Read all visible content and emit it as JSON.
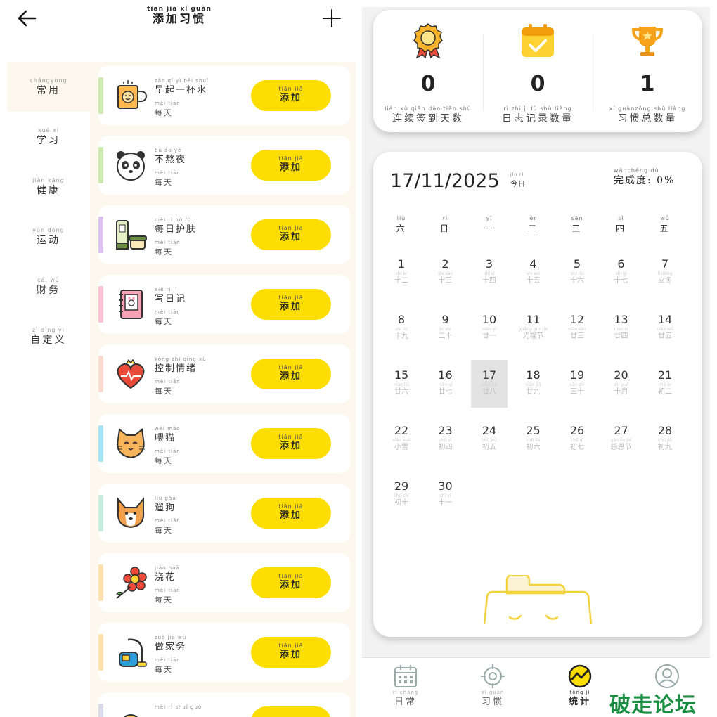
{
  "header": {
    "title_py": "tiān jiā  xí guàn",
    "title": "添加习惯"
  },
  "sidebar": {
    "items": [
      {
        "py": "chángyòng",
        "label": "常用"
      },
      {
        "py": "xué  xí",
        "label": "学习"
      },
      {
        "py": "jiàn kāng",
        "label": "健康"
      },
      {
        "py": "yùn dòng",
        "label": "运动"
      },
      {
        "py": "cái  wù",
        "label": "财务"
      },
      {
        "py": "zì dìng yì",
        "label": "自定义"
      }
    ]
  },
  "habits": [
    {
      "py": "zǎo  qǐ   yì  bēi shuǐ",
      "name": "早起一杯水",
      "freq_py": "měi tiān",
      "freq": "每天",
      "icon": "mug-icon",
      "bar": "#cdeab0",
      "add_py": "tiān jiā",
      "add": "添加"
    },
    {
      "py": "bù   áo   yè",
      "name": "不熬夜",
      "freq_py": "měi tiān",
      "freq": "每天",
      "icon": "panda-icon",
      "bar": "#cdeab0",
      "add_py": "tiān jiā",
      "add": "添加"
    },
    {
      "py": "měi  rì   hù   fū",
      "name": "每日护肤",
      "freq_py": "měi tiān",
      "freq": "每天",
      "icon": "skincare-icon",
      "bar": "#dcc2ef",
      "add_py": "tiān jiā",
      "add": "添加"
    },
    {
      "py": "xiě  rì   jì",
      "name": "写日记",
      "freq_py": "měi tiān",
      "freq": "每天",
      "icon": "diary-icon",
      "bar": "#f9c4d6",
      "add_py": "tiān jiā",
      "add": "添加"
    },
    {
      "py": "kòng zhì qíng xù",
      "name": "控制情绪",
      "freq_py": "měi tiān",
      "freq": "每天",
      "icon": "heart-icon",
      "bar": "#fcdcd0",
      "add_py": "tiān jiā",
      "add": "添加"
    },
    {
      "py": "wèi māo",
      "name": "喂猫",
      "freq_py": "měi tiān",
      "freq": "每天",
      "icon": "cat-icon",
      "bar": "#a9e2f0",
      "add_py": "tiān jiā",
      "add": "添加"
    },
    {
      "py": "liù  gǒu",
      "name": "遛狗",
      "freq_py": "měi tiān",
      "freq": "每天",
      "icon": "dog-icon",
      "bar": "#c9ecdd",
      "add_py": "tiān jiā",
      "add": "添加"
    },
    {
      "py": "jiāo huā",
      "name": "浇花",
      "freq_py": "měi tiān",
      "freq": "每天",
      "icon": "flower-icon",
      "bar": "#fde1b0",
      "add_py": "tiān jiā",
      "add": "添加"
    },
    {
      "py": "zuò  jiā  wù",
      "name": "做家务",
      "freq_py": "měi tiān",
      "freq": "每天",
      "icon": "vacuum-icon",
      "bar": "#fde1b0",
      "add_py": "tiān jiā",
      "add": "添加"
    },
    {
      "py": "měi  rì shuǐ guǒ",
      "name": "",
      "freq_py": "",
      "freq": "",
      "icon": "fruit-icon",
      "bar": "#dcdcec",
      "add_py": "",
      "add": ""
    }
  ],
  "stats": [
    {
      "icon": "medal-icon",
      "value": "0",
      "py": "lián  xù  qiān dào tiān shù",
      "label": "连续签到天数"
    },
    {
      "icon": "calendar-check-icon",
      "value": "0",
      "py": "rì   zhì   jì   lù  shù liàng",
      "label": "日志记录数量"
    },
    {
      "icon": "trophy-icon",
      "value": "1",
      "py": "xí  guànzǒng shù liàng",
      "label": "习惯总数量"
    }
  ],
  "calendar": {
    "date": "17/11/2025",
    "today_py": "jīn rì",
    "today": "今日",
    "progress_py": "wánchéng dù",
    "progress_label": "完成度:",
    "progress_value": "0%",
    "weekdays": [
      {
        "py": "liù",
        "label": "六"
      },
      {
        "py": "rì",
        "label": "日"
      },
      {
        "py": "yī",
        "label": "一"
      },
      {
        "py": "èr",
        "label": "二"
      },
      {
        "py": "sān",
        "label": "三"
      },
      {
        "py": "sì",
        "label": "四"
      },
      {
        "py": "wǔ",
        "label": "五"
      }
    ],
    "selected_day": "17",
    "days": [
      {
        "num": "1",
        "lunar_py": "shí èr",
        "lunar": "十二"
      },
      {
        "num": "2",
        "lunar_py": "shí sān",
        "lunar": "十三"
      },
      {
        "num": "3",
        "lunar_py": "shí sì",
        "lunar": "十四"
      },
      {
        "num": "4",
        "lunar_py": "shí wǔ",
        "lunar": "十五"
      },
      {
        "num": "5",
        "lunar_py": "shí liù",
        "lunar": "十六"
      },
      {
        "num": "6",
        "lunar_py": "shí qī",
        "lunar": "十七"
      },
      {
        "num": "7",
        "lunar_py": "lì dōng",
        "lunar": "立冬"
      },
      {
        "num": "8",
        "lunar_py": "shí jiǔ",
        "lunar": "十九"
      },
      {
        "num": "9",
        "lunar_py": "èr shí",
        "lunar": "二十"
      },
      {
        "num": "10",
        "lunar_py": "niàn yī",
        "lunar": "廿一"
      },
      {
        "num": "11",
        "lunar_py": "guāng gùn jié",
        "lunar": "光棍节"
      },
      {
        "num": "12",
        "lunar_py": "niàn sān",
        "lunar": "廿三"
      },
      {
        "num": "13",
        "lunar_py": "niàn sì",
        "lunar": "廿四"
      },
      {
        "num": "14",
        "lunar_py": "niàn wǔ",
        "lunar": "廿五"
      },
      {
        "num": "15",
        "lunar_py": "niàn liù",
        "lunar": "廿六"
      },
      {
        "num": "16",
        "lunar_py": "niàn qī",
        "lunar": "廿七"
      },
      {
        "num": "17",
        "lunar_py": "niàn bā",
        "lunar": "廿八"
      },
      {
        "num": "18",
        "lunar_py": "niàn jiǔ",
        "lunar": "廿九"
      },
      {
        "num": "19",
        "lunar_py": "sān shí",
        "lunar": "三十"
      },
      {
        "num": "20",
        "lunar_py": "shí yuè",
        "lunar": "十月"
      },
      {
        "num": "21",
        "lunar_py": "chū èr",
        "lunar": "初二"
      },
      {
        "num": "22",
        "lunar_py": "xiǎo xuě",
        "lunar": "小雪"
      },
      {
        "num": "23",
        "lunar_py": "chū sì",
        "lunar": "初四"
      },
      {
        "num": "24",
        "lunar_py": "chū wǔ",
        "lunar": "初五"
      },
      {
        "num": "25",
        "lunar_py": "chū liù",
        "lunar": "初六"
      },
      {
        "num": "26",
        "lunar_py": "chū qī",
        "lunar": "初七"
      },
      {
        "num": "27",
        "lunar_py": "gǎn ēn jié",
        "lunar": "感恩节"
      },
      {
        "num": "28",
        "lunar_py": "chū jiǔ",
        "lunar": "初九"
      },
      {
        "num": "29",
        "lunar_py": "chū shí",
        "lunar": "初十"
      },
      {
        "num": "30",
        "lunar_py": "shí yī",
        "lunar": "十一"
      }
    ]
  },
  "bottom_nav": [
    {
      "icon": "calendar-icon",
      "py": "rì  cháng",
      "label": "日常",
      "active": false
    },
    {
      "icon": "target-icon",
      "py": "xí  guàn",
      "label": "习惯",
      "active": false
    },
    {
      "icon": "stats-icon",
      "py": "tǒng  jì",
      "label": "统计",
      "active": true
    },
    {
      "icon": "profile-icon",
      "py": "",
      "label": "",
      "active": false
    }
  ],
  "watermark": "破走论坛",
  "colors": {
    "accent": "#fedd00",
    "background_warm": "#fdf8ee",
    "watermark": "#1a8f43"
  }
}
